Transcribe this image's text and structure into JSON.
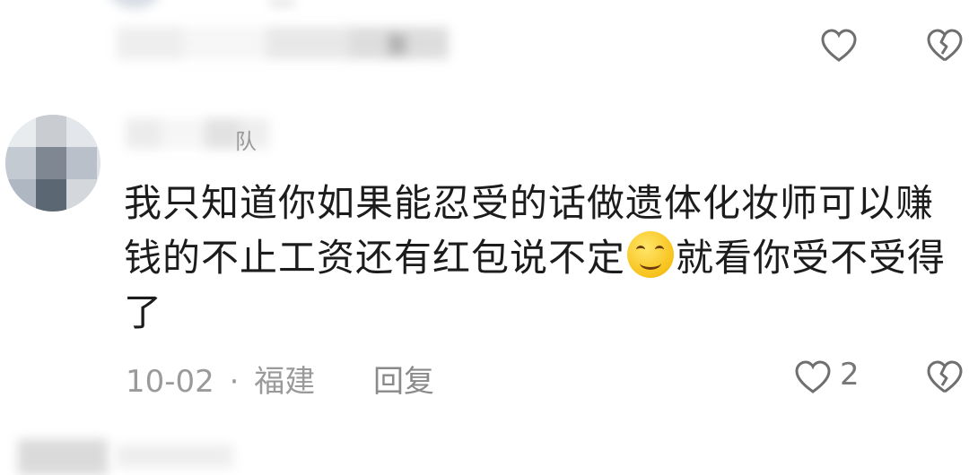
{
  "top_comment": {
    "name_fragment": "...",
    "meta_fragment": "复"
  },
  "comment": {
    "username_tail": "队",
    "text_part1": "我只知道你如果能忍受的话做遗体化妆师可以赚钱的不止工资还有红包说不定",
    "emoji": "smile-emoji",
    "text_part2": "就看你受不受得了",
    "date": "10-02",
    "separator": "·",
    "location": "福建",
    "reply_label": "回复",
    "like_count": "2"
  },
  "icons": {
    "like": "heart-outline-icon",
    "dislike": "broken-heart-icon"
  },
  "colors": {
    "text": "#1f1f1f",
    "meta": "#9a9a9a",
    "icon": "#6f6f6f"
  }
}
